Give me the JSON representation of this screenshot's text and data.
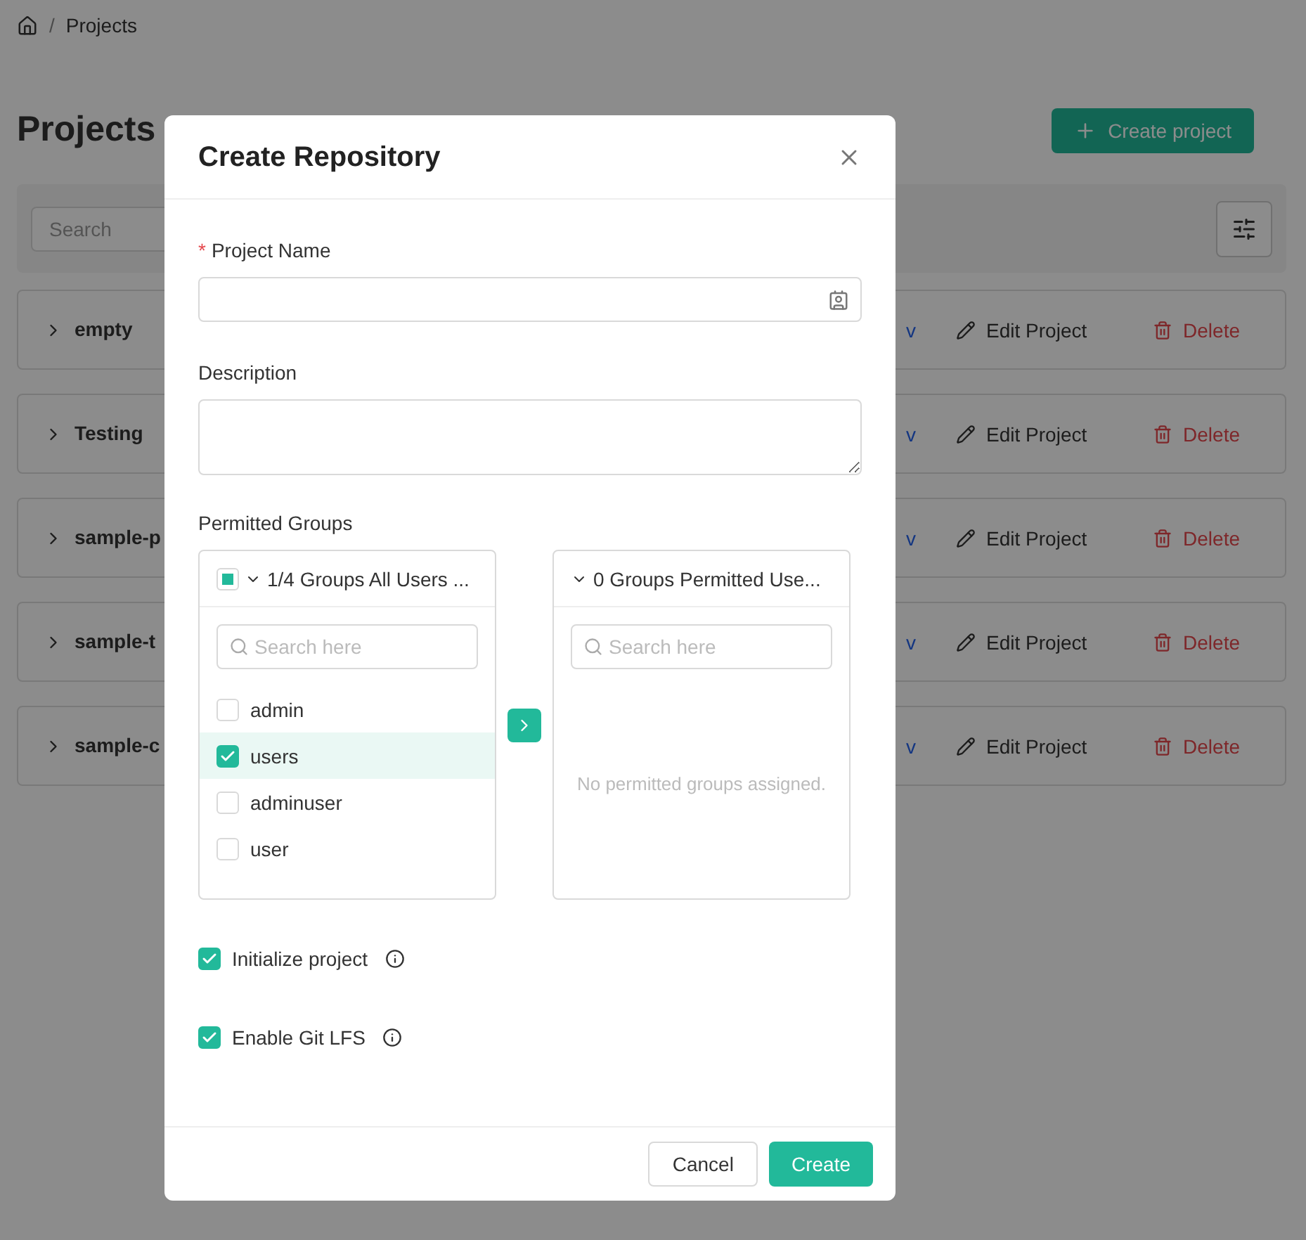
{
  "breadcrumb": {
    "separator": "/",
    "items": [
      "Projects"
    ]
  },
  "page": {
    "title": "Projects",
    "create_button": "Create project",
    "search": {
      "placeholder": "Search"
    },
    "projects": [
      {
        "name": "empty",
        "view_link": "v",
        "edit": "Edit Project",
        "delete": "Delete"
      },
      {
        "name": "Testing",
        "view_link": "v",
        "edit": "Edit Project",
        "delete": "Delete"
      },
      {
        "name": "sample-p",
        "view_link": "v",
        "edit": "Edit Project",
        "delete": "Delete"
      },
      {
        "name": "sample-t",
        "view_link": "v",
        "edit": "Edit Project",
        "delete": "Delete"
      },
      {
        "name": "sample-c",
        "view_link": "v",
        "edit": "Edit Project",
        "delete": "Delete"
      }
    ]
  },
  "dialog": {
    "title": "Create Repository",
    "project_name": {
      "label": "Project Name",
      "required": true,
      "required_mark": "*"
    },
    "description": {
      "label": "Description"
    },
    "permitted_groups": {
      "label": "Permitted Groups",
      "source": {
        "title": "1/4 Groups All Users ...",
        "indeterminate": true,
        "search_placeholder": "Search here",
        "items": [
          {
            "label": "admin",
            "checked": false
          },
          {
            "label": "users",
            "checked": true
          },
          {
            "label": "adminuser",
            "checked": false
          },
          {
            "label": "user",
            "checked": false
          }
        ]
      },
      "target": {
        "title": "0 Groups Permitted Use...",
        "search_placeholder": "Search here",
        "empty_text": "No permitted groups assigned."
      }
    },
    "options": [
      {
        "label": "Initialize project",
        "checked": true
      },
      {
        "label": "Enable Git LFS",
        "checked": true
      }
    ],
    "buttons": {
      "cancel": "Cancel",
      "create": "Create"
    }
  }
}
